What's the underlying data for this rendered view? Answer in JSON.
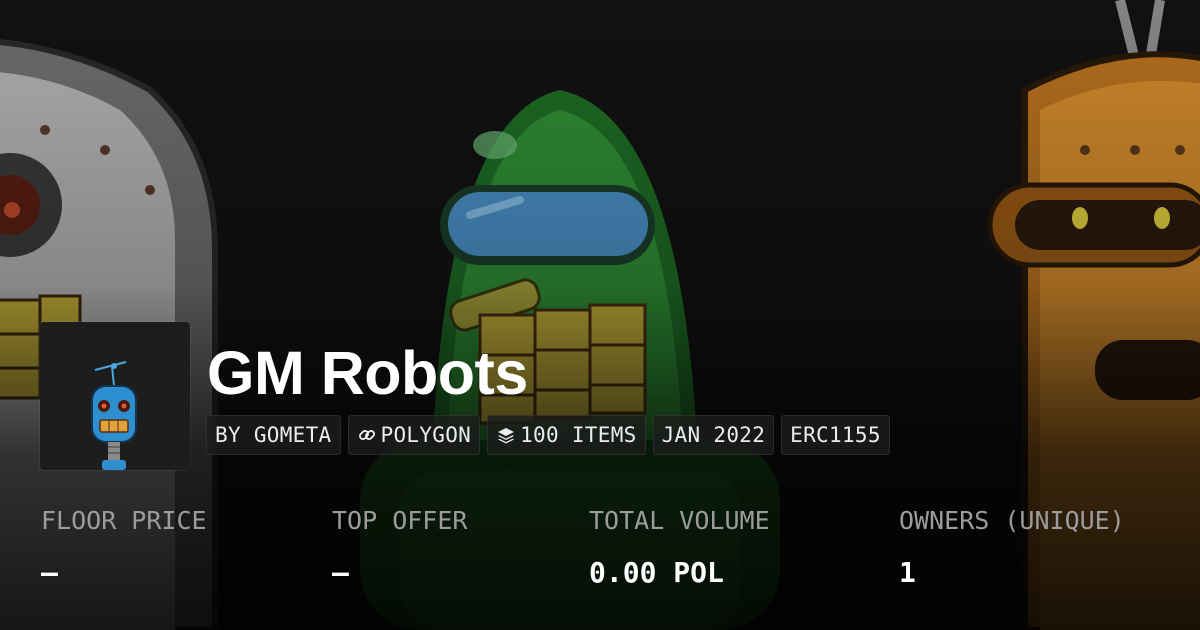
{
  "collection": {
    "name": "GM Robots",
    "chips": {
      "creator": "BY GOMETA",
      "chain": "POLYGON",
      "items": "100 ITEMS",
      "date": "JAN 2022",
      "standard": "ERC1155"
    },
    "chip_icons": {
      "chain": "chain-link-icon",
      "items": "layers-stack-icon"
    }
  },
  "stats": {
    "floor_price": {
      "label": "FLOOR PRICE",
      "value": "–"
    },
    "top_offer": {
      "label": "TOP OFFER",
      "value": "–"
    },
    "total_volume": {
      "label": "TOTAL VOLUME",
      "value": "0.00 POL"
    },
    "owners": {
      "label": "OWNERS (UNIQUE)",
      "value": "1"
    }
  },
  "colors": {
    "background": "#121212",
    "robot_green": "#2f8f35",
    "robot_orange": "#d48b2c",
    "robot_grey": "#a7a7a7",
    "label_grey": "#9c9c9c"
  }
}
